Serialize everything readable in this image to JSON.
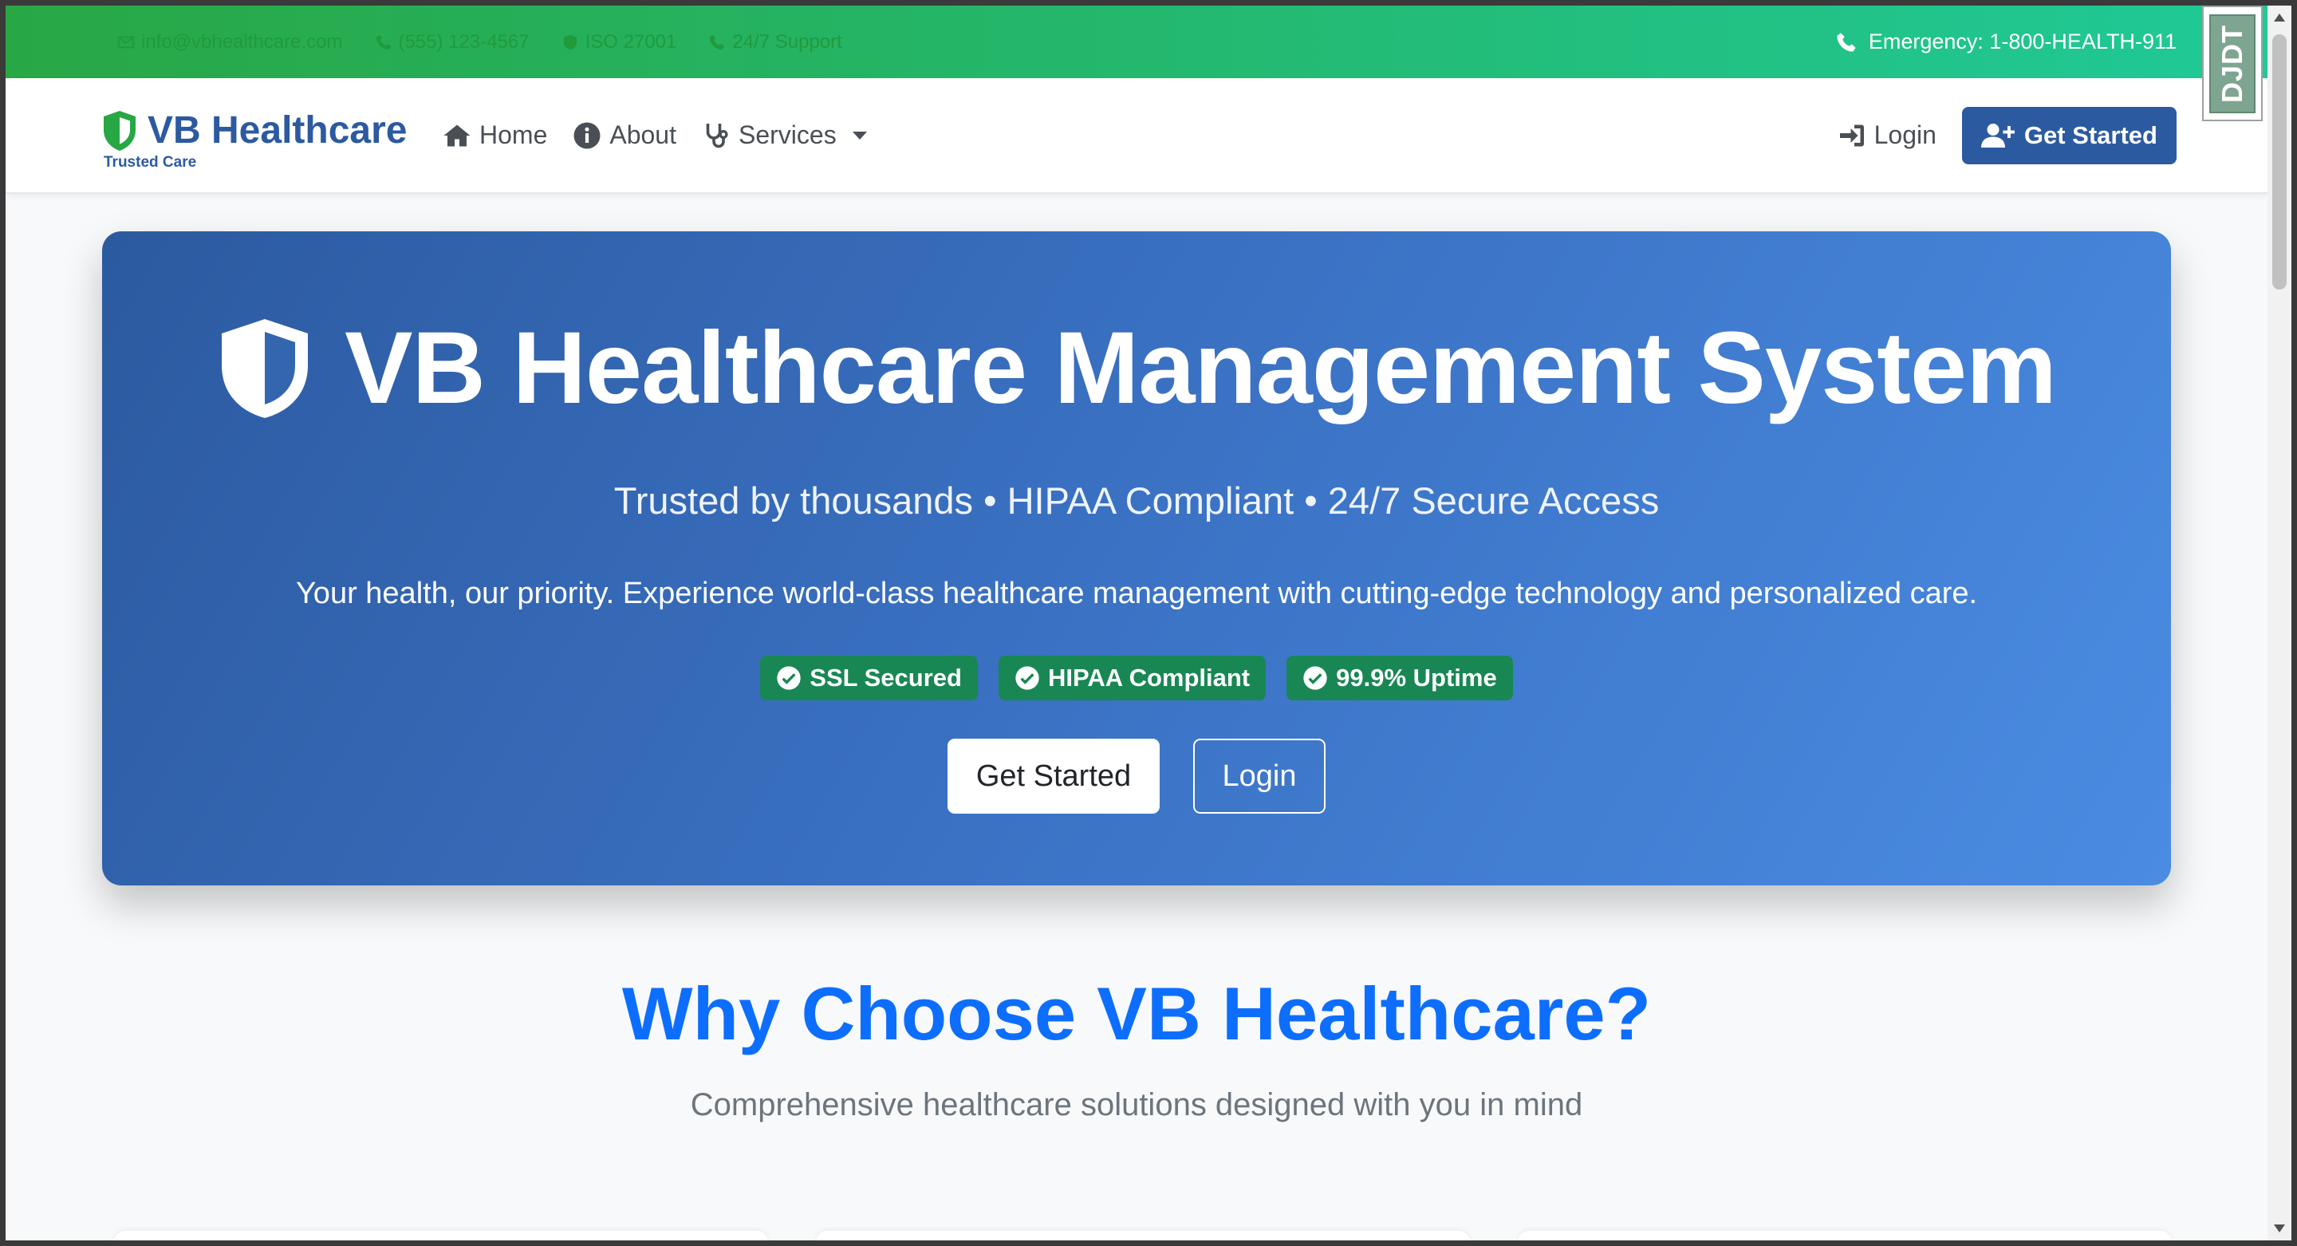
{
  "topbar": {
    "items": [
      "info@vbhealthcare.com",
      "(555) 123-4567",
      "ISO 27001",
      "24/7 Support"
    ],
    "emergency": "Emergency: 1-800-HEALTH-911"
  },
  "nav": {
    "brand_name": "VB Healthcare",
    "brand_tagline": "Trusted Care",
    "links": [
      {
        "label": "Home",
        "icon": "home-icon"
      },
      {
        "label": "About",
        "icon": "info-icon"
      },
      {
        "label": "Services",
        "icon": "stethoscope-icon"
      }
    ],
    "login_label": "Login",
    "get_started_label": "Get Started"
  },
  "hero": {
    "title": "VB Healthcare Management System",
    "subtitle": "Trusted by thousands • HIPAA Compliant • 24/7 Secure Access",
    "description": "Your health, our priority. Experience world-class healthcare management with cutting-edge technology and personalized care.",
    "badges": [
      "SSL Secured",
      "HIPAA Compliant",
      "99.9% Uptime"
    ],
    "primary_button": "Get Started",
    "secondary_button": "Login"
  },
  "features": {
    "title": "Why Choose VB Healthcare?",
    "subtitle": "Comprehensive healthcare solutions designed with you in mind"
  },
  "debug_toolbar": {
    "label": "DJDT"
  },
  "colors": {
    "brand": "#2c5aa0",
    "topbar_start": "#28a745",
    "topbar_end": "#20c997",
    "badge": "#198754",
    "section_title": "#0d6efd"
  }
}
